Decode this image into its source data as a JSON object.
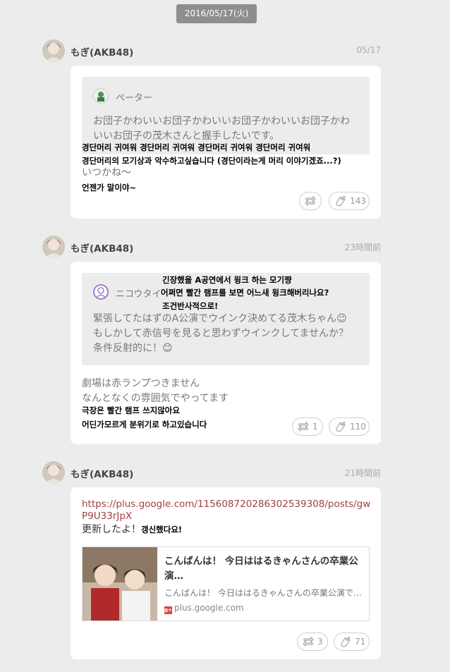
{
  "date_header": "2016/05/17(火)",
  "posts": [
    {
      "author": "もぎ(AKB48)",
      "time": "05/17",
      "quote": {
        "author": "ペーター",
        "text_jp_1": "お団子かわいいお団子かわいいお団子かわいいお団子かわ",
        "text_jp_2": "いいお団子の茂木さんと握手したいです。",
        "text_kr_1": "경단머리 귀여워 경단머리 귀여워 경단머리 귀여워 경단머리 귀여워",
        "text_kr_2": "경단머리의 모기상과 악수하고싶습니다 (경단이라는게 머리 이야기겠죠...?)"
      },
      "reply_jp": "いつかね〜",
      "reply_kr": "언젠가 말이야~",
      "retweet_count": "",
      "like_count": "143"
    },
    {
      "author": "もぎ(AKB48)",
      "time": "23時間前",
      "quote": {
        "author": "ニコウタイ",
        "kr_top_1": "긴장했을 A공연에서 윙크 하는 모기쨩",
        "kr_top_2": "어쩌면 빨간 램프를 보면 어느새 윙크해버리나요?",
        "kr_top_3": "조건반사적으로!",
        "text_jp_1": "緊張してたはずのA公演でウインク決めてる茂木ちゃん😉",
        "text_jp_2": "もしかして赤信号を見ると思わずウインクしてませんか？",
        "text_jp_3": "条件反射的に！😊"
      },
      "reply_jp_1": "劇場は赤ランプつきません",
      "reply_jp_2": "なんとなくの雰囲気でやってます",
      "reply_kr_1": "극장은 빨간 램프 쓰지않아요",
      "reply_kr_2": "어딘가모르게 분위기로 하고있습니다",
      "retweet_count": "1",
      "like_count": "110"
    },
    {
      "author": "もぎ(AKB48)",
      "time": "21時間前",
      "link": "https://plus.google.com/115608720286302539308/posts/gwP9U33rJpX",
      "text_jp": "更新したよ！",
      "text_kr": "갱신했다요!",
      "preview": {
        "title": "こんばんは！ 今日ははるきゃんさんの卒業公演…",
        "description": "こんばんは！ 今日ははるきゃんさんの卒業公演で…",
        "source": "plus.google.com"
      },
      "retweet_count": "3",
      "like_count": "71"
    }
  ],
  "colors": {
    "background": "#ececec",
    "card": "#ffffff",
    "quote_bg": "#ececec",
    "link": "#a04242",
    "date_pill": "#8e8e8e"
  },
  "icons": [
    "avatar",
    "retweet-icon",
    "clap-icon",
    "google-plus-icon"
  ]
}
